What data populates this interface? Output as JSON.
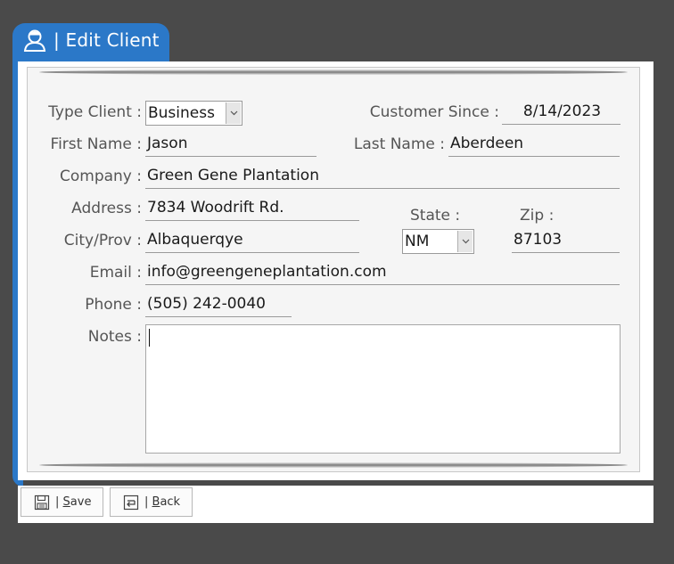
{
  "window": {
    "title": "| Edit Client",
    "title_icon": "user-icon",
    "accent_color": "#2b78c8"
  },
  "form": {
    "type_client": {
      "label": "Type Client :",
      "value": "Business"
    },
    "customer_since": {
      "label": "Customer Since :",
      "value": "8/14/2023"
    },
    "first_name": {
      "label": "First Name :",
      "value": "Jason"
    },
    "last_name": {
      "label": "Last Name :",
      "value": "Aberdeen"
    },
    "company": {
      "label": "Company :",
      "value": "Green Gene Plantation"
    },
    "address": {
      "label": "Address :",
      "value": "7834 Woodrift Rd."
    },
    "state": {
      "label": "State :",
      "value": "NM"
    },
    "zip": {
      "label": "Zip :",
      "value": "87103"
    },
    "city": {
      "label": "City/Prov :",
      "value": "Albaquerqye"
    },
    "email": {
      "label": "Email :",
      "value": "info@greengeneplantation.com"
    },
    "phone": {
      "label": "Phone :",
      "value": "(505) 242-0040"
    },
    "notes": {
      "label": "Notes :",
      "value": ""
    }
  },
  "toolbar": {
    "save_prefix": "| ",
    "save_mnemonic": "S",
    "save_rest": "ave",
    "save_icon": "floppy-disk-icon",
    "back_prefix": "| ",
    "back_mnemonic": "B",
    "back_rest": "ack",
    "back_icon": "back-arrow-icon"
  }
}
